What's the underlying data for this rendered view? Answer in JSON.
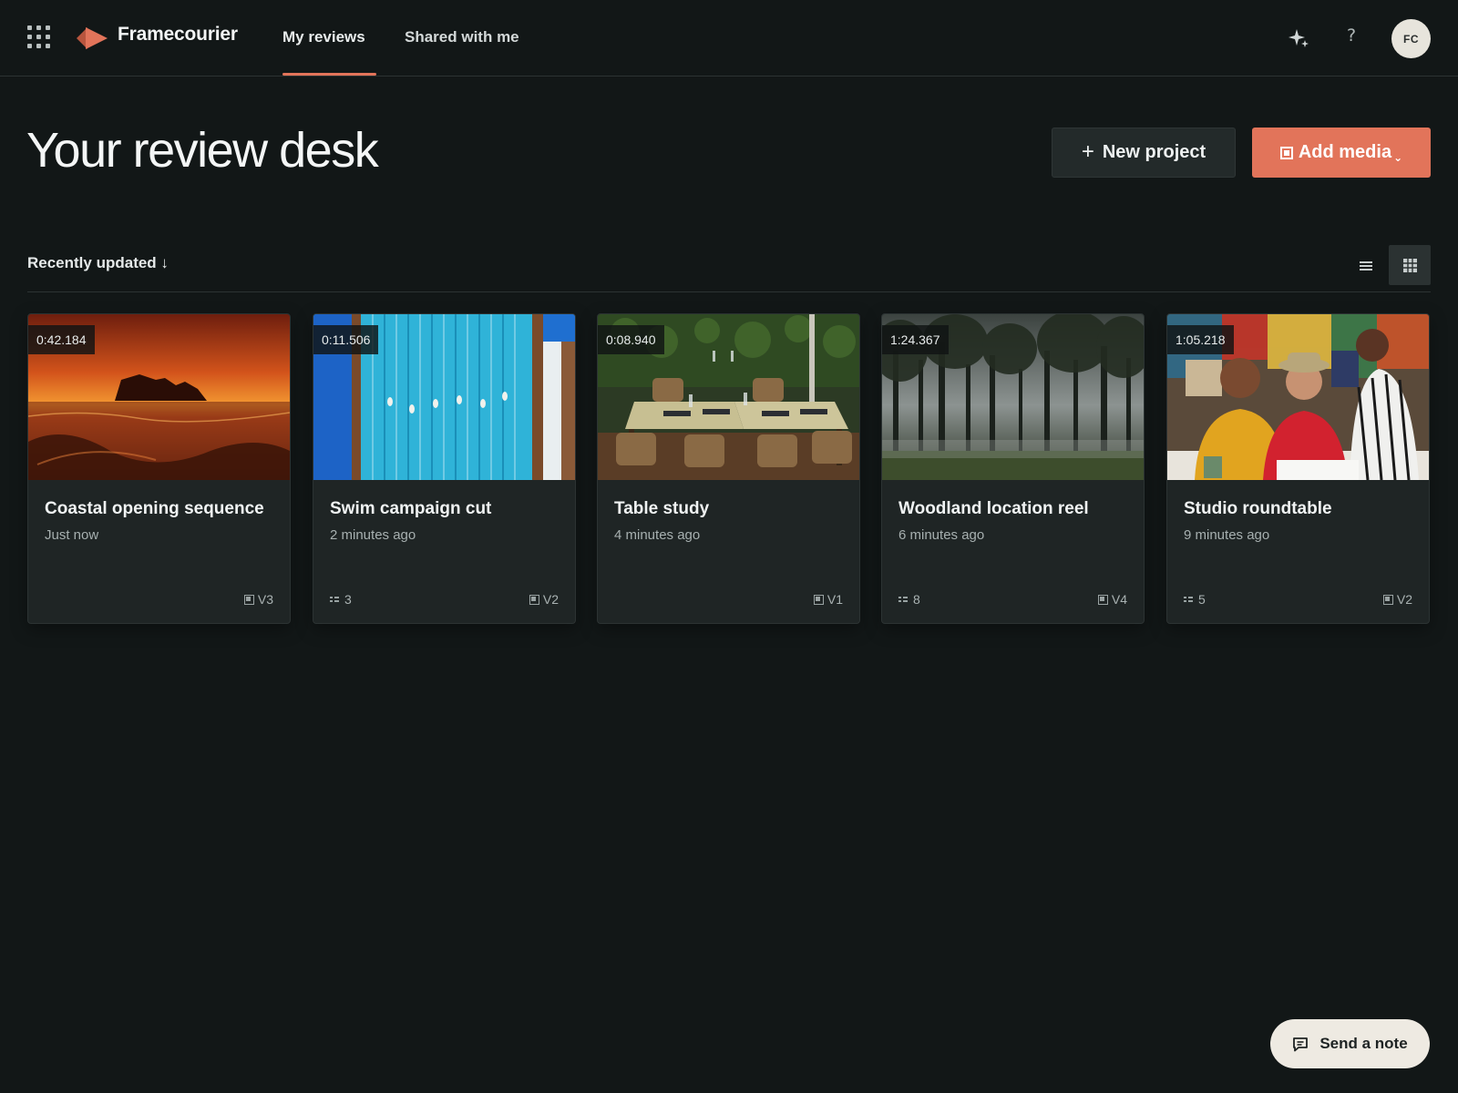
{
  "app": {
    "name": "Framecourier",
    "accent": "#e2745a"
  },
  "nav": {
    "tabs": [
      {
        "label": "My reviews",
        "active": true
      },
      {
        "label": "Shared with me",
        "active": false
      }
    ]
  },
  "header_actions": {
    "help": "?",
    "avatar_initials": "FC"
  },
  "page": {
    "title": "Your review desk",
    "new_project_label": "New project",
    "new_project_icon": "+",
    "add_media_label": "Add media",
    "add_media_caret": "⌄"
  },
  "toolbar": {
    "sort_label": "Recently updated ↓",
    "view_mode": "grid"
  },
  "cards": [
    {
      "title": "Coastal opening sequence",
      "updated": "Just now",
      "duration": "0:42.184",
      "comments": "",
      "version": "V3",
      "thumb": "sunset-coast"
    },
    {
      "title": "Swim campaign cut",
      "updated": "2 minutes ago",
      "duration": "0:11.506",
      "comments": "3",
      "version": "V2",
      "thumb": "pool-aerial"
    },
    {
      "title": "Table study",
      "updated": "4 minutes ago",
      "duration": "0:08.940",
      "comments": "",
      "version": "V1",
      "thumb": "restaurant-terrace"
    },
    {
      "title": "Woodland location reel",
      "updated": "6 minutes ago",
      "duration": "1:24.367",
      "comments": "8",
      "version": "V4",
      "thumb": "misty-forest"
    },
    {
      "title": "Studio roundtable",
      "updated": "9 minutes ago",
      "duration": "1:05.218",
      "comments": "5",
      "version": "V2",
      "thumb": "studio-people"
    }
  ],
  "feedback": {
    "label": "Send a note"
  }
}
